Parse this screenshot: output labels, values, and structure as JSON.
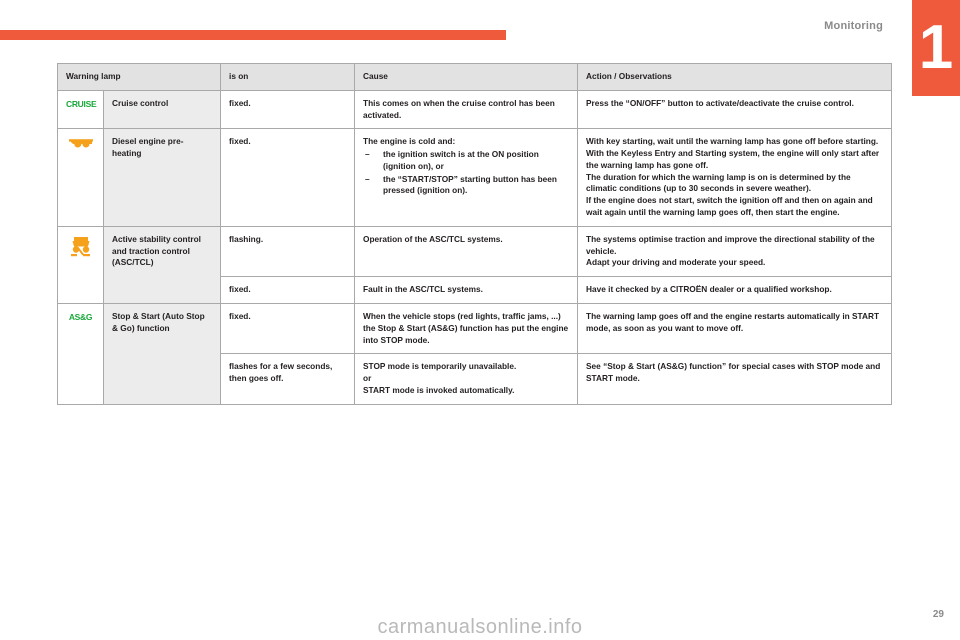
{
  "header": {
    "title": "Monitoring",
    "chapter_number": "1",
    "accent_color": "#f05a3c"
  },
  "table": {
    "columns": [
      "Warning lamp",
      "is on",
      "Cause",
      "Action / Observations"
    ],
    "rows": [
      {
        "lamp_icon": "cruise-control-lamp-icon",
        "lamp_text": "CRUISE",
        "name": "Cruise control",
        "states": [
          {
            "is_on": "fixed.",
            "cause_paragraphs": [
              "This comes on when the cruise control has been activated."
            ],
            "cause_bullets": [],
            "action_paragraphs": [
              "Press the “ON/OFF” button to activate/deactivate the cruise control."
            ]
          }
        ]
      },
      {
        "lamp_icon": "diesel-preheating-coil-icon",
        "lamp_text": "",
        "name": "Diesel engine pre-heating",
        "states": [
          {
            "is_on": "fixed.",
            "cause_paragraphs": [
              "The engine is cold and:"
            ],
            "cause_bullets": [
              "the ignition switch is at the ON position (ignition on), or",
              "the “START/STOP” starting button has been pressed (ignition on)."
            ],
            "action_paragraphs": [
              "With key starting, wait until the warning lamp has gone off before starting.",
              "With the Keyless Entry and Starting system, the engine will only start after the warning lamp has gone off.",
              "The duration for which the warning lamp is on is determined by the climatic conditions (up to 30 seconds in severe weather).",
              "If the engine does not start, switch the ignition off and then on again and wait again until the warning lamp goes off, then start the engine."
            ]
          }
        ]
      },
      {
        "lamp_icon": "asc-tcl-skidding-car-icon",
        "lamp_text": "",
        "name": "Active stability control and traction control (ASC/TCL)",
        "states": [
          {
            "is_on": "flashing.",
            "cause_paragraphs": [
              "Operation of the ASC/TCL systems."
            ],
            "cause_bullets": [],
            "action_paragraphs": [
              "The systems optimise traction and improve the directional stability of the vehicle.",
              "Adapt your driving and moderate your speed."
            ]
          },
          {
            "is_on": "fixed.",
            "cause_paragraphs": [
              "Fault in the ASC/TCL systems."
            ],
            "cause_bullets": [],
            "action_paragraphs": [
              "Have it checked by a CITROËN dealer or a qualified workshop."
            ]
          }
        ]
      },
      {
        "lamp_icon": "stop-start-asg-lamp-icon",
        "lamp_text": "AS&G",
        "name": "Stop & Start (Auto Stop & Go) function",
        "states": [
          {
            "is_on": "fixed.",
            "cause_paragraphs": [
              "When the vehicle stops (red lights, traffic jams, ...) the Stop & Start (AS&G) function has put the engine into STOP mode."
            ],
            "cause_bullets": [],
            "action_paragraphs": [
              "The warning lamp goes off and the engine restarts automatically in START mode, as soon as you want to move off."
            ]
          },
          {
            "is_on": "flashes for a few seconds, then goes off.",
            "cause_paragraphs": [
              "STOP mode is temporarily unavailable.",
              "or",
              "START mode is invoked automatically."
            ],
            "cause_bullets": [],
            "action_paragraphs": [
              "See “Stop & Start (AS&G) function” for special cases with STOP mode and START mode."
            ]
          }
        ]
      }
    ]
  },
  "footer": {
    "page_number": "29",
    "watermark": "carmanualsonline.info"
  }
}
